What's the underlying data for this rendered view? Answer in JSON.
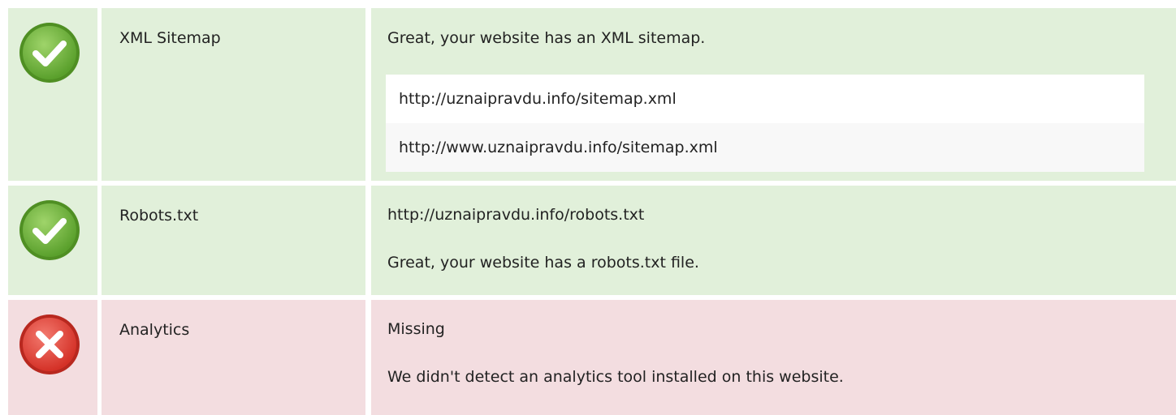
{
  "checks": [
    {
      "status": "pass",
      "icon": "check-circle-icon",
      "label": "XML Sitemap",
      "message": "Great, your website has an XML sitemap.",
      "urls": [
        "http://uznaipravdu.info/sitemap.xml",
        "http://www.uznaipravdu.info/sitemap.xml"
      ]
    },
    {
      "status": "pass",
      "icon": "check-circle-icon",
      "label": "Robots.txt",
      "lines": [
        "http://uznaipravdu.info/robots.txt",
        "Great, your website has a robots.txt file."
      ]
    },
    {
      "status": "fail",
      "icon": "cross-circle-icon",
      "label": "Analytics",
      "lines": [
        "Missing",
        "We didn't detect an analytics tool installed on this website."
      ]
    }
  ],
  "colors": {
    "pass_bg": "#e1f0da",
    "fail_bg": "#f3dde0",
    "pass_icon": "#6db33f",
    "fail_icon": "#e2453c"
  }
}
